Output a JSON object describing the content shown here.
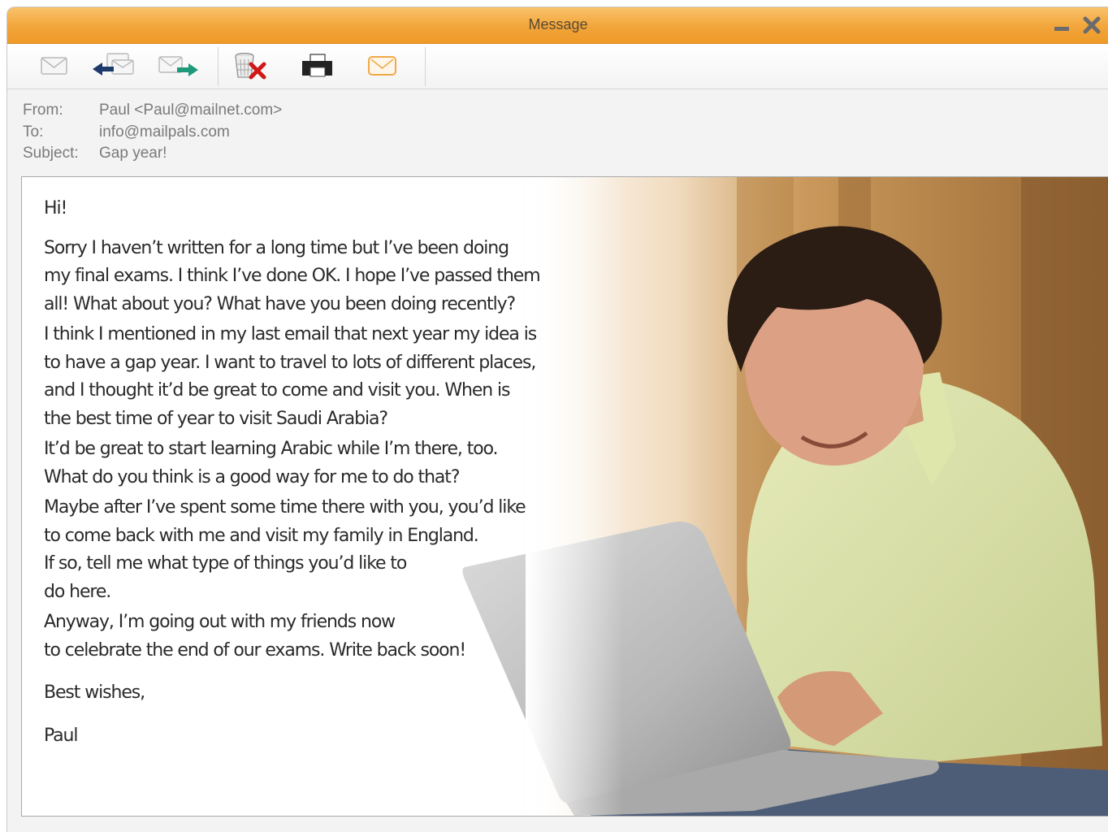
{
  "window": {
    "title": "Message",
    "minimize_icon": "minimize-icon",
    "close_icon": "close-icon"
  },
  "toolbar": {
    "buttons": [
      {
        "name": "new-message-button",
        "icon": "envelope-icon"
      },
      {
        "name": "reply-button",
        "icon": "reply-icon"
      },
      {
        "name": "forward-button",
        "icon": "forward-icon"
      },
      {
        "name": "delete-button",
        "icon": "trash-delete-icon"
      },
      {
        "name": "print-button",
        "icon": "printer-icon"
      },
      {
        "name": "mark-button",
        "icon": "orange-envelope-icon"
      }
    ]
  },
  "header": {
    "from_label": "From:",
    "from_value": "Paul <Paul@mailnet.com>",
    "to_label": "To:",
    "to_value": "info@mailpals.com",
    "subject_label": "Subject:",
    "subject_value": "Gap year!"
  },
  "message": {
    "greeting": "Hi!",
    "p1": [
      "Sorry I haven’t written for a long time but I’ve been doing",
      "my final exams. I think I’ve done OK. I hope I’ve passed them",
      "all! What about you? What have you been doing recently?"
    ],
    "p2": [
      "I think I mentioned in my last email that next year my idea is",
      "to have a gap year. I want to travel to lots of different places,",
      "and I thought it’d be great to come and visit you. When is",
      "the best time of year to visit Saudi Arabia?"
    ],
    "p3": [
      "It’d be great to start learning Arabic while I’m there, too.",
      "What do you think is a good way for me to do that?"
    ],
    "p4": [
      "Maybe after I’ve spent some time there with you, you’d like",
      "to come back with me and visit my family in England.",
      "If so, tell me what type of things you’d like to",
      "do here."
    ],
    "p5": [
      "Anyway, I’m going out with my friends now",
      "to celebrate the end of our exams. Write back soon!"
    ],
    "signoff": "Best wishes,",
    "signature": "Paul"
  },
  "colors": {
    "title_bar": "#f2a53a",
    "window_bg": "#f3f3f3",
    "text": "#2a2a2a"
  }
}
